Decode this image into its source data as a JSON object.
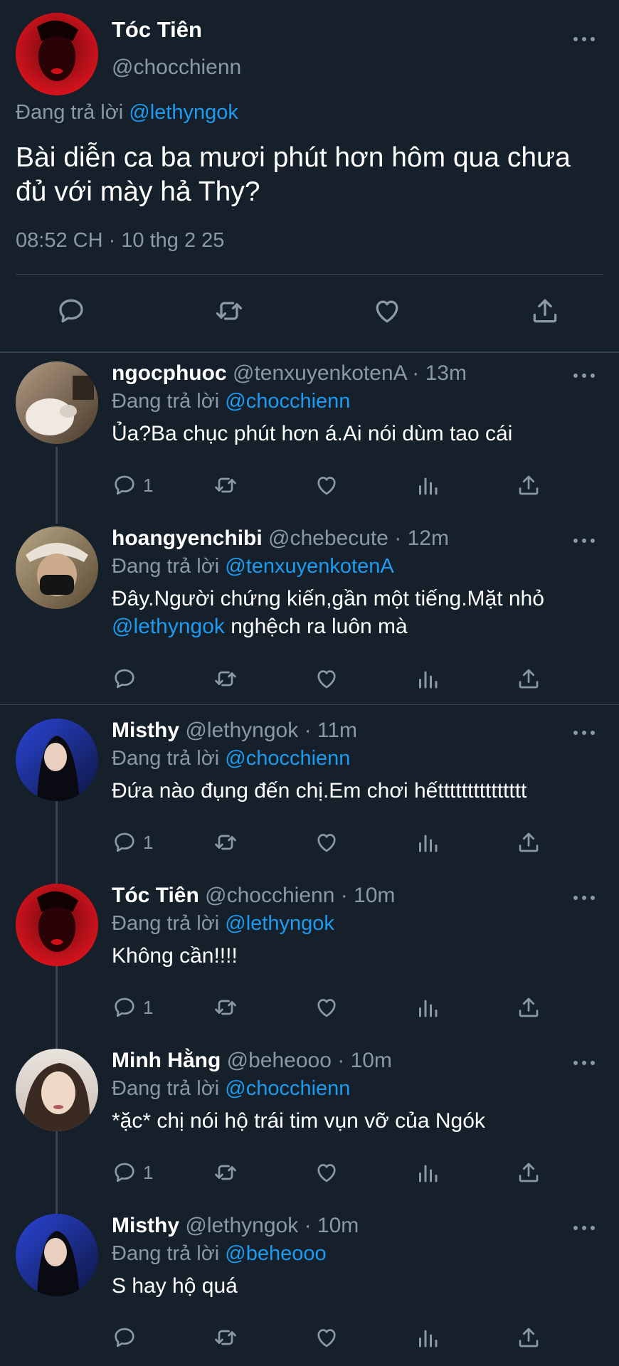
{
  "main": {
    "name": "Tóc Tiên",
    "handle": "@chocchienn",
    "reply_prefix": "Đang trả lời",
    "reply_to": "@lethyngok",
    "text": "Bài diễn ca ba mươi phút hơn hôm qua chưa đủ với mày hả Thy?",
    "timestamp": "08:52 CH · 10 thg 2 25"
  },
  "replies": [
    {
      "name": "ngocphuoc",
      "handle": "@tenxuyenkotenA · 13m",
      "reply_prefix": "Đang trả lời",
      "reply_to": "@chocchienn",
      "text": "Ủa?Ba chục phút hơn á.Ai nói dùm tao cái",
      "reply_count": "1"
    },
    {
      "name": "hoangyenchibi",
      "handle": "@chebecute · 12m",
      "reply_prefix": "Đang trả lời",
      "reply_to": "@tenxuyenkotenA",
      "text_before": "Đây.Người chứng kiến,gần một tiếng.Mặt nhỏ ",
      "text_mention": "@lethyngok",
      "text_after": " nghệch ra luôn mà",
      "reply_count": ""
    },
    {
      "name": "Misthy",
      "handle": "@lethyngok · 11m",
      "reply_prefix": "Đang trả lời",
      "reply_to": "@chocchienn",
      "text": "Đứa nào đụng đến chị.Em chơi hếttttttttttttttt",
      "reply_count": "1"
    },
    {
      "name": "Tóc Tiên",
      "handle": "@chocchienn · 10m",
      "reply_prefix": "Đang trả lời",
      "reply_to": "@lethyngok",
      "text": "Không cần!!!!",
      "reply_count": "1"
    },
    {
      "name": "Minh Hằng",
      "handle": "@beheooo · 10m",
      "reply_prefix": "Đang trả lời",
      "reply_to": "@chocchienn",
      "text": "*ặc* chị nói hộ trái tim vụn vỡ của Ngók",
      "reply_count": "1"
    },
    {
      "name": "Misthy",
      "handle": "@lethyngok · 10m",
      "reply_prefix": "Đang trả lời",
      "reply_to": "@beheooo",
      "text": "S hay hộ quá",
      "reply_count": ""
    }
  ],
  "icons": [
    "reply-icon",
    "retweet-icon",
    "like-icon",
    "analytics-icon",
    "share-icon",
    "more-icon"
  ],
  "colors": {
    "background": "#15202b",
    "text": "#ffffff",
    "secondary": "#8b98a5",
    "accent": "#1d9bf0",
    "divider": "#38444d"
  }
}
